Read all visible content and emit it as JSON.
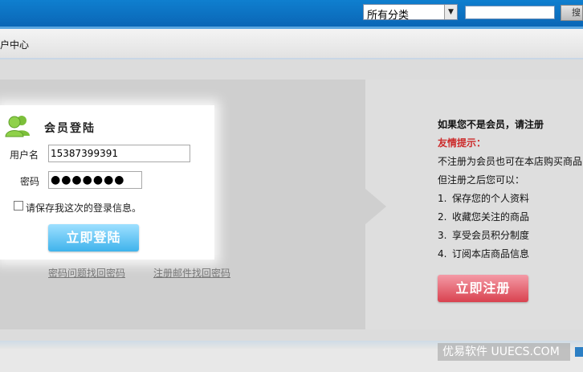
{
  "header": {
    "category_select": "所有分类",
    "search_button": "搜"
  },
  "nav": {
    "member_center": "户中心"
  },
  "login": {
    "title": "会员登陆",
    "username_label": "用户名",
    "username_value": "15387399391",
    "password_label": "密码",
    "password_value": "●●●●●●●",
    "remember_label": "请保存我这次的登录信息。",
    "login_button": "立即登陆",
    "forgot_by_question": "密码问题找回密码",
    "forgot_by_email": "注册邮件找回密码"
  },
  "register": {
    "title": "如果您不是会员，请注册",
    "tip_title": "友情提示：",
    "paragraph1": "不注册为会员也可在本店购买商品",
    "paragraph2": "但注册之后您可以：",
    "benefits": [
      {
        "num": "1.",
        "text": "保存您的个人资料"
      },
      {
        "num": "2.",
        "text": "收藏您关注的商品"
      },
      {
        "num": "3.",
        "text": "享受会员积分制度"
      },
      {
        "num": "4.",
        "text": "订阅本店商品信息"
      }
    ],
    "register_button": "立即注册"
  },
  "watermark": "优易软件 UUECS.COM",
  "colors": {
    "topbar": "#0a6fc0",
    "login_button": "#3fb3ec",
    "register_button": "#d9424f",
    "tip": "#cc2b2b"
  }
}
